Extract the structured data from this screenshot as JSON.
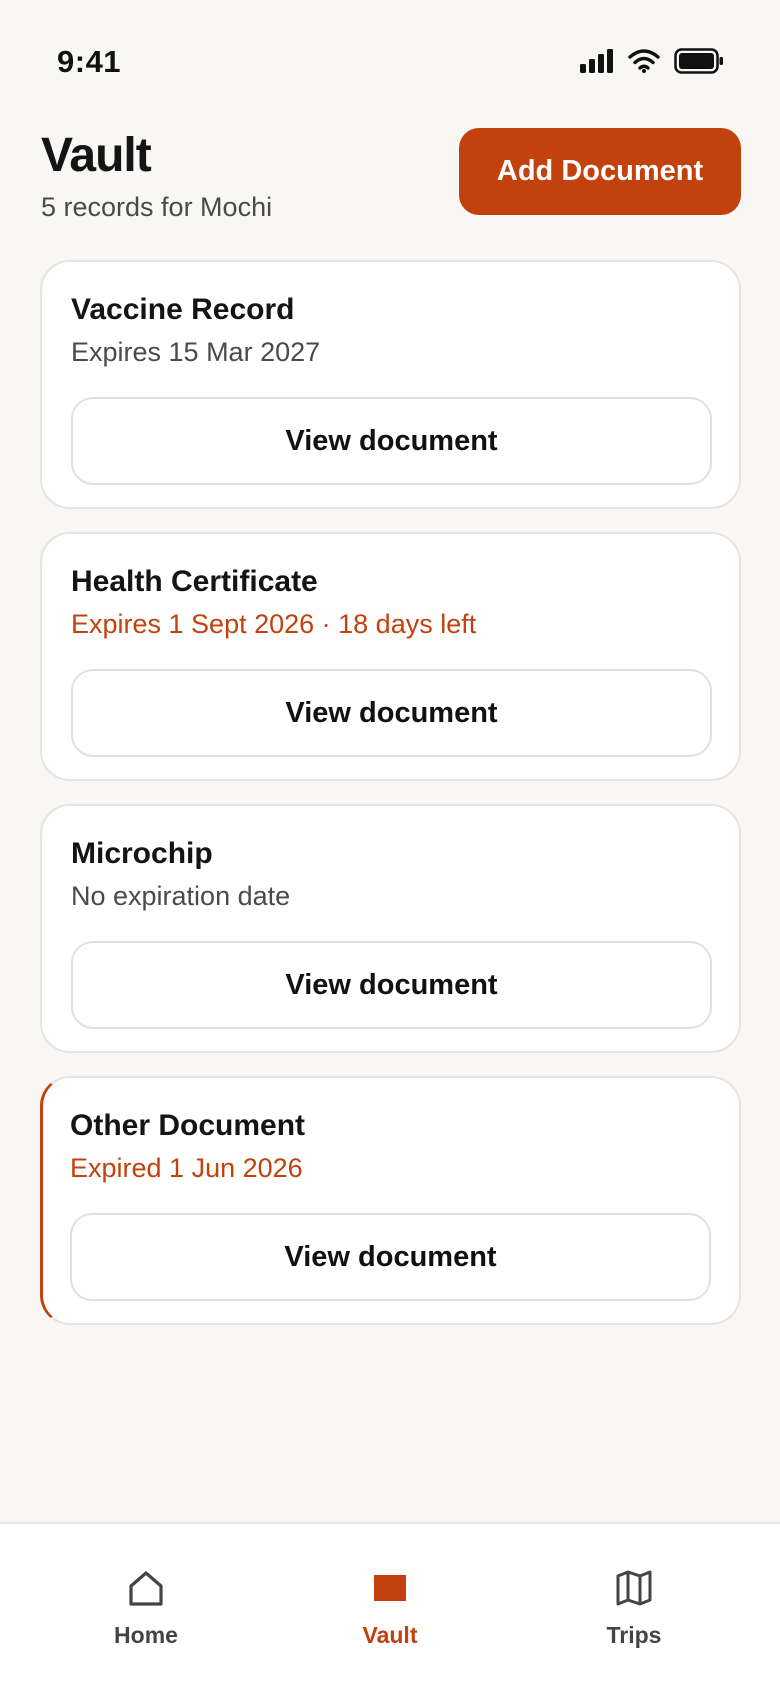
{
  "status_bar": {
    "time": "9:41"
  },
  "header": {
    "title": "Vault",
    "subtitle": "5 records for Mochi",
    "add_button_label": "Add Document"
  },
  "documents": [
    {
      "title": "Vaccine Record",
      "status": "Expires 15 Mar 2027",
      "status_tone": "normal",
      "action_label": "View document"
    },
    {
      "title": "Health Certificate",
      "status": "Expires 1 Sept 2026 · 18 days left",
      "status_tone": "warning",
      "action_label": "View document"
    },
    {
      "title": "Microchip",
      "status": "No expiration date",
      "status_tone": "normal",
      "action_label": "View document"
    },
    {
      "title": "Other Document",
      "status": "Expired 1 Jun 2026",
      "status_tone": "expired",
      "action_label": "View document"
    }
  ],
  "tab_bar": {
    "tabs": [
      {
        "label": "Home",
        "icon": "home-icon",
        "active": false
      },
      {
        "label": "Vault",
        "icon": "vault-icon",
        "active": true
      },
      {
        "label": "Trips",
        "icon": "map-icon",
        "active": false
      }
    ]
  },
  "colors": {
    "accent": "#c2410c",
    "background": "#f8f7f4",
    "card": "#ffffff",
    "border": "#e7e4de"
  }
}
